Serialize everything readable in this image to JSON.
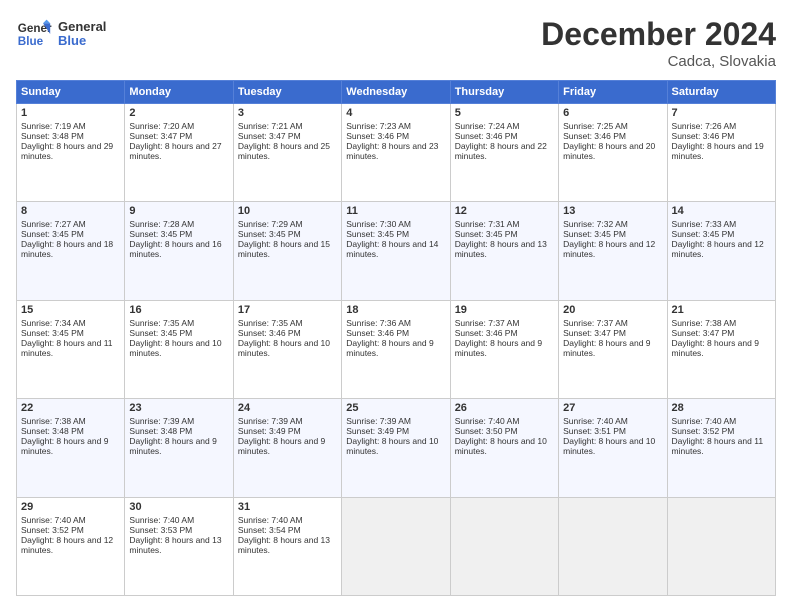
{
  "logo": {
    "line1": "General",
    "line2": "Blue"
  },
  "title": "December 2024",
  "location": "Cadca, Slovakia",
  "days_of_week": [
    "Sunday",
    "Monday",
    "Tuesday",
    "Wednesday",
    "Thursday",
    "Friday",
    "Saturday"
  ],
  "weeks": [
    [
      {
        "day": 1,
        "sunrise": "7:19 AM",
        "sunset": "3:48 PM",
        "daylight": "8 hours and 29 minutes."
      },
      {
        "day": 2,
        "sunrise": "7:20 AM",
        "sunset": "3:47 PM",
        "daylight": "8 hours and 27 minutes."
      },
      {
        "day": 3,
        "sunrise": "7:21 AM",
        "sunset": "3:47 PM",
        "daylight": "8 hours and 25 minutes."
      },
      {
        "day": 4,
        "sunrise": "7:23 AM",
        "sunset": "3:46 PM",
        "daylight": "8 hours and 23 minutes."
      },
      {
        "day": 5,
        "sunrise": "7:24 AM",
        "sunset": "3:46 PM",
        "daylight": "8 hours and 22 minutes."
      },
      {
        "day": 6,
        "sunrise": "7:25 AM",
        "sunset": "3:46 PM",
        "daylight": "8 hours and 20 minutes."
      },
      {
        "day": 7,
        "sunrise": "7:26 AM",
        "sunset": "3:46 PM",
        "daylight": "8 hours and 19 minutes."
      }
    ],
    [
      {
        "day": 8,
        "sunrise": "7:27 AM",
        "sunset": "3:45 PM",
        "daylight": "8 hours and 18 minutes."
      },
      {
        "day": 9,
        "sunrise": "7:28 AM",
        "sunset": "3:45 PM",
        "daylight": "8 hours and 16 minutes."
      },
      {
        "day": 10,
        "sunrise": "7:29 AM",
        "sunset": "3:45 PM",
        "daylight": "8 hours and 15 minutes."
      },
      {
        "day": 11,
        "sunrise": "7:30 AM",
        "sunset": "3:45 PM",
        "daylight": "8 hours and 14 minutes."
      },
      {
        "day": 12,
        "sunrise": "7:31 AM",
        "sunset": "3:45 PM",
        "daylight": "8 hours and 13 minutes."
      },
      {
        "day": 13,
        "sunrise": "7:32 AM",
        "sunset": "3:45 PM",
        "daylight": "8 hours and 12 minutes."
      },
      {
        "day": 14,
        "sunrise": "7:33 AM",
        "sunset": "3:45 PM",
        "daylight": "8 hours and 12 minutes."
      }
    ],
    [
      {
        "day": 15,
        "sunrise": "7:34 AM",
        "sunset": "3:45 PM",
        "daylight": "8 hours and 11 minutes."
      },
      {
        "day": 16,
        "sunrise": "7:35 AM",
        "sunset": "3:45 PM",
        "daylight": "8 hours and 10 minutes."
      },
      {
        "day": 17,
        "sunrise": "7:35 AM",
        "sunset": "3:46 PM",
        "daylight": "8 hours and 10 minutes."
      },
      {
        "day": 18,
        "sunrise": "7:36 AM",
        "sunset": "3:46 PM",
        "daylight": "8 hours and 9 minutes."
      },
      {
        "day": 19,
        "sunrise": "7:37 AM",
        "sunset": "3:46 PM",
        "daylight": "8 hours and 9 minutes."
      },
      {
        "day": 20,
        "sunrise": "7:37 AM",
        "sunset": "3:47 PM",
        "daylight": "8 hours and 9 minutes."
      },
      {
        "day": 21,
        "sunrise": "7:38 AM",
        "sunset": "3:47 PM",
        "daylight": "8 hours and 9 minutes."
      }
    ],
    [
      {
        "day": 22,
        "sunrise": "7:38 AM",
        "sunset": "3:48 PM",
        "daylight": "8 hours and 9 minutes."
      },
      {
        "day": 23,
        "sunrise": "7:39 AM",
        "sunset": "3:48 PM",
        "daylight": "8 hours and 9 minutes."
      },
      {
        "day": 24,
        "sunrise": "7:39 AM",
        "sunset": "3:49 PM",
        "daylight": "8 hours and 9 minutes."
      },
      {
        "day": 25,
        "sunrise": "7:39 AM",
        "sunset": "3:49 PM",
        "daylight": "8 hours and 10 minutes."
      },
      {
        "day": 26,
        "sunrise": "7:40 AM",
        "sunset": "3:50 PM",
        "daylight": "8 hours and 10 minutes."
      },
      {
        "day": 27,
        "sunrise": "7:40 AM",
        "sunset": "3:51 PM",
        "daylight": "8 hours and 10 minutes."
      },
      {
        "day": 28,
        "sunrise": "7:40 AM",
        "sunset": "3:52 PM",
        "daylight": "8 hours and 11 minutes."
      }
    ],
    [
      {
        "day": 29,
        "sunrise": "7:40 AM",
        "sunset": "3:52 PM",
        "daylight": "8 hours and 12 minutes."
      },
      {
        "day": 30,
        "sunrise": "7:40 AM",
        "sunset": "3:53 PM",
        "daylight": "8 hours and 13 minutes."
      },
      {
        "day": 31,
        "sunrise": "7:40 AM",
        "sunset": "3:54 PM",
        "daylight": "8 hours and 13 minutes."
      },
      null,
      null,
      null,
      null
    ]
  ]
}
